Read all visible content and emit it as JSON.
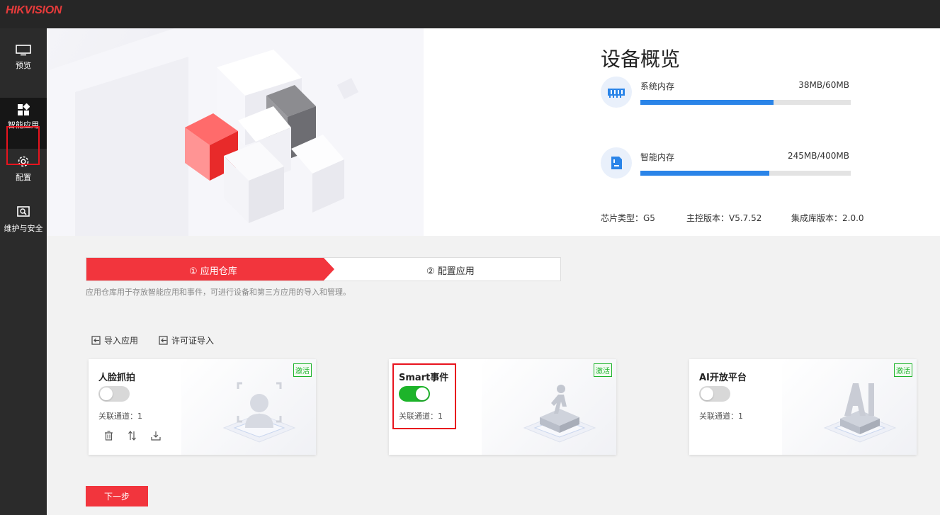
{
  "brand": {
    "logo": "HIKVISION"
  },
  "sidebar": {
    "items": [
      {
        "label": "预览",
        "icon": "monitor-icon"
      },
      {
        "label": "智能应用",
        "icon": "apps-grid-icon",
        "active": true
      },
      {
        "label": "配置",
        "icon": "gear-icon"
      },
      {
        "label": "维护与安全",
        "icon": "maintenance-icon"
      }
    ]
  },
  "overview": {
    "title": "设备概览",
    "system_memory": {
      "label": "系统内存",
      "value": "38MB/60MB",
      "used_fraction": 0.633
    },
    "smart_memory": {
      "label": "智能内存",
      "value": "245MB/400MB",
      "used_fraction": 0.6125
    },
    "chip_type": "芯片类型：G5",
    "main_version": "主控版本：V5.7.52",
    "lib_version": "集成库版本：2.0.0"
  },
  "steps": {
    "step1": "① 应用仓库",
    "step2": "② 配置应用",
    "description": "应用仓库用于存放智能应用和事件，可进行设备和第三方应用的导入和管理。"
  },
  "toolbar": {
    "import_app": "导入应用",
    "license_import": "许可证导入"
  },
  "cards": [
    {
      "title": "人脸抓拍",
      "enabled": false,
      "channel": "关联通道：1",
      "badge": "激活"
    },
    {
      "title": "Smart事件",
      "enabled": true,
      "channel": "关联通道：1",
      "badge": "激活"
    },
    {
      "title": "AI开放平台",
      "enabled": false,
      "channel": "关联通道：1",
      "badge": "激活"
    }
  ],
  "next_button": "下一步",
  "colors": {
    "accent": "#f2353d",
    "progress": "#2a84e8",
    "toggle_on": "#1db42a"
  }
}
